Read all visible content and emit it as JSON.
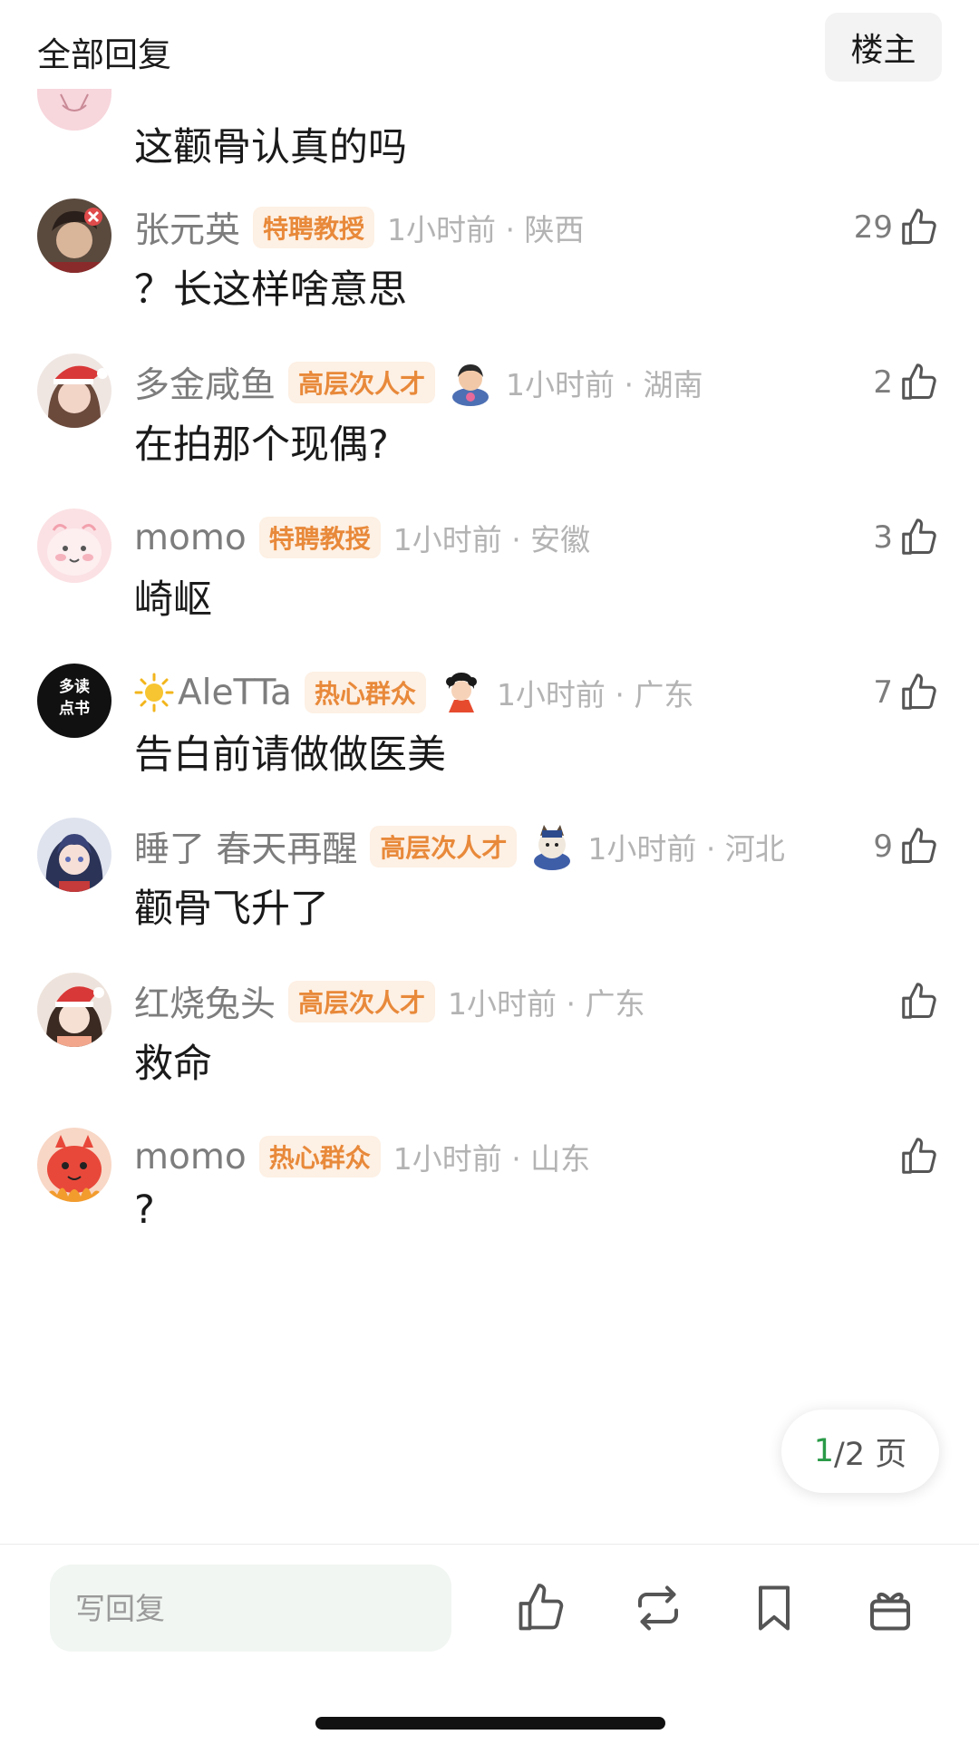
{
  "header": {
    "title": "全部回复",
    "owner_button": "楼主"
  },
  "partial_comment": {
    "text": "这颧骨认真的吗"
  },
  "comments": [
    {
      "name": "张元英",
      "badge": "特聘教授",
      "time": "1小时前 · 陕西",
      "text": "？长这样啥意思",
      "likes": "29"
    },
    {
      "name": "多金咸鱼",
      "badge": "高层次人才",
      "time": "1小时前 · 湖南",
      "text": "在拍那个现偶?",
      "likes": "2"
    },
    {
      "name": "momo",
      "badge": "特聘教授",
      "time": "1小时前 · 安徽",
      "text": "崎岖",
      "likes": "3"
    },
    {
      "name": "AleTTa",
      "badge": "热心群众",
      "time": "1小时前 · 广东",
      "text": "告白前请做做医美",
      "likes": "7"
    },
    {
      "name": "睡了 春天再醒",
      "badge": "高层次人才",
      "time": "1小时前 · 河北",
      "text": "颧骨飞升了",
      "likes": "9"
    },
    {
      "name": "红烧兔头",
      "badge": "高层次人才",
      "time": "1小时前 · 广东",
      "text": "救命",
      "likes": ""
    },
    {
      "name": "momo",
      "badge": "热心群众",
      "time": "1小时前 · 山东",
      "text": "?",
      "likes": ""
    }
  ],
  "avatar_badges": {
    "aletta": "多读\n点书"
  },
  "pagination": {
    "current": "1",
    "rest": "/2 页"
  },
  "bottom_bar": {
    "reply_placeholder": "写回复"
  },
  "colors": {
    "badge_text": "#e8893a",
    "badge_bg": "#fdf0e4",
    "page_current": "#2a9a48"
  }
}
